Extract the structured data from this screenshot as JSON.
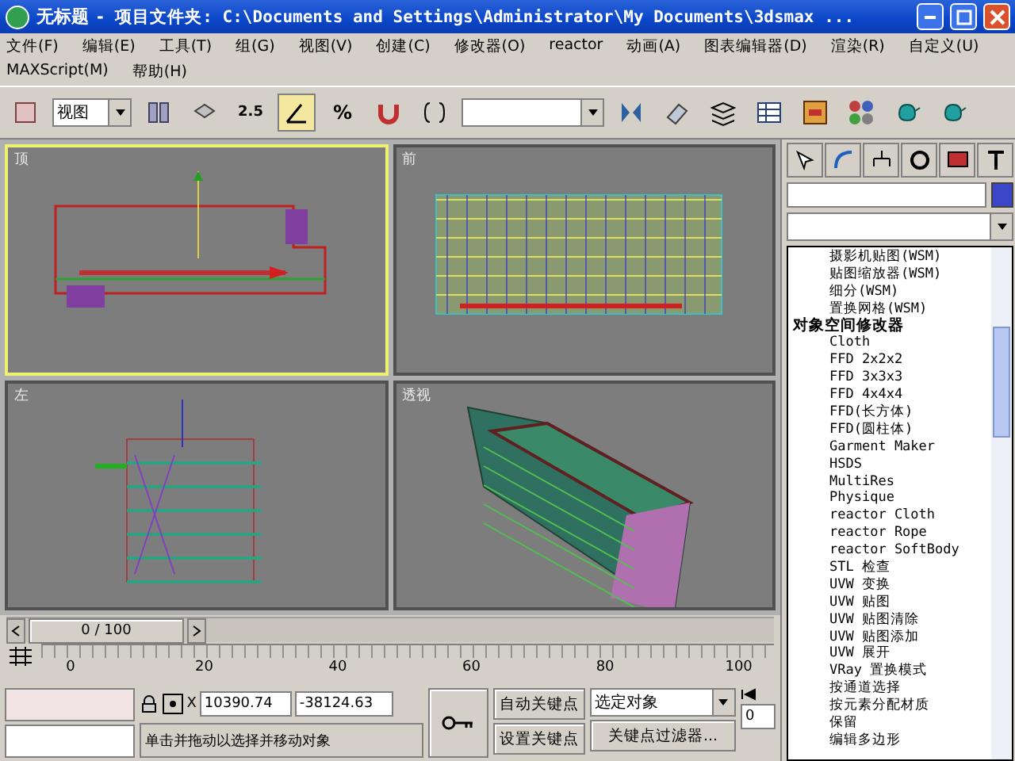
{
  "window": {
    "title": "无标题",
    "path": "- 项目文件夹: C:\\Documents and Settings\\Administrator\\My Documents\\3dsmax ..."
  },
  "menu": [
    "文件(F)",
    "编辑(E)",
    "工具(T)",
    "组(G)",
    "视图(V)",
    "创建(C)",
    "修改器(O)",
    "reactor",
    "动画(A)",
    "图表编辑器(D)",
    "渲染(R)",
    "自定义(U)",
    "MAXScript(M)",
    "帮助(H)"
  ],
  "toolbar": {
    "view_dropdown": "视图",
    "snap_label": "2.5",
    "percent_label": "%"
  },
  "viewports": [
    {
      "label": "顶",
      "selected": true,
      "kind": "top"
    },
    {
      "label": "前",
      "selected": false,
      "kind": "front"
    },
    {
      "label": "左",
      "selected": false,
      "kind": "left"
    },
    {
      "label": "透视",
      "selected": false,
      "kind": "perspective"
    }
  ],
  "time_slider": {
    "label": "0 / 100",
    "level": 0
  },
  "track": {
    "ticks": [
      "0",
      "20",
      "40",
      "60",
      "80",
      "100"
    ]
  },
  "status": {
    "x_label": "X",
    "x_value": "10390.74",
    "y_value": "-38124.63",
    "prompt": "单击并拖动以选择并移动对象",
    "auto_key": "自动关键点",
    "set_key": "设置关键点",
    "key_mode": "选定对象",
    "key_filters": "关键点过滤器...",
    "frame": "0"
  },
  "command_panel": {
    "modifier_list": [
      {
        "label": "摄影机贴图(WSM)",
        "kind": "item"
      },
      {
        "label": "贴图缩放器(WSM)",
        "kind": "item"
      },
      {
        "label": "细分(WSM)",
        "kind": "item"
      },
      {
        "label": "置换网格(WSM)",
        "kind": "item"
      },
      {
        "label": "对象空间修改器",
        "kind": "header"
      },
      {
        "label": "Cloth",
        "kind": "item"
      },
      {
        "label": "FFD 2x2x2",
        "kind": "item"
      },
      {
        "label": "FFD 3x3x3",
        "kind": "item"
      },
      {
        "label": "FFD 4x4x4",
        "kind": "item"
      },
      {
        "label": "FFD(长方体)",
        "kind": "item"
      },
      {
        "label": "FFD(圆柱体)",
        "kind": "item"
      },
      {
        "label": "Garment Maker",
        "kind": "item"
      },
      {
        "label": "HSDS",
        "kind": "item"
      },
      {
        "label": "MultiRes",
        "kind": "item"
      },
      {
        "label": "Physique",
        "kind": "item"
      },
      {
        "label": "reactor Cloth",
        "kind": "item"
      },
      {
        "label": "reactor Rope",
        "kind": "item"
      },
      {
        "label": "reactor SoftBody",
        "kind": "item"
      },
      {
        "label": "STL 检查",
        "kind": "item"
      },
      {
        "label": "UVW 变换",
        "kind": "item"
      },
      {
        "label": "UVW 贴图",
        "kind": "item"
      },
      {
        "label": "UVW 贴图清除",
        "kind": "item"
      },
      {
        "label": "UVW 贴图添加",
        "kind": "item"
      },
      {
        "label": "UVW 展开",
        "kind": "item"
      },
      {
        "label": "VRay 置换模式",
        "kind": "item"
      },
      {
        "label": "按通道选择",
        "kind": "item"
      },
      {
        "label": "按元素分配材质",
        "kind": "item"
      },
      {
        "label": "保留",
        "kind": "item"
      },
      {
        "label": "编辑多边形",
        "kind": "item"
      }
    ]
  }
}
